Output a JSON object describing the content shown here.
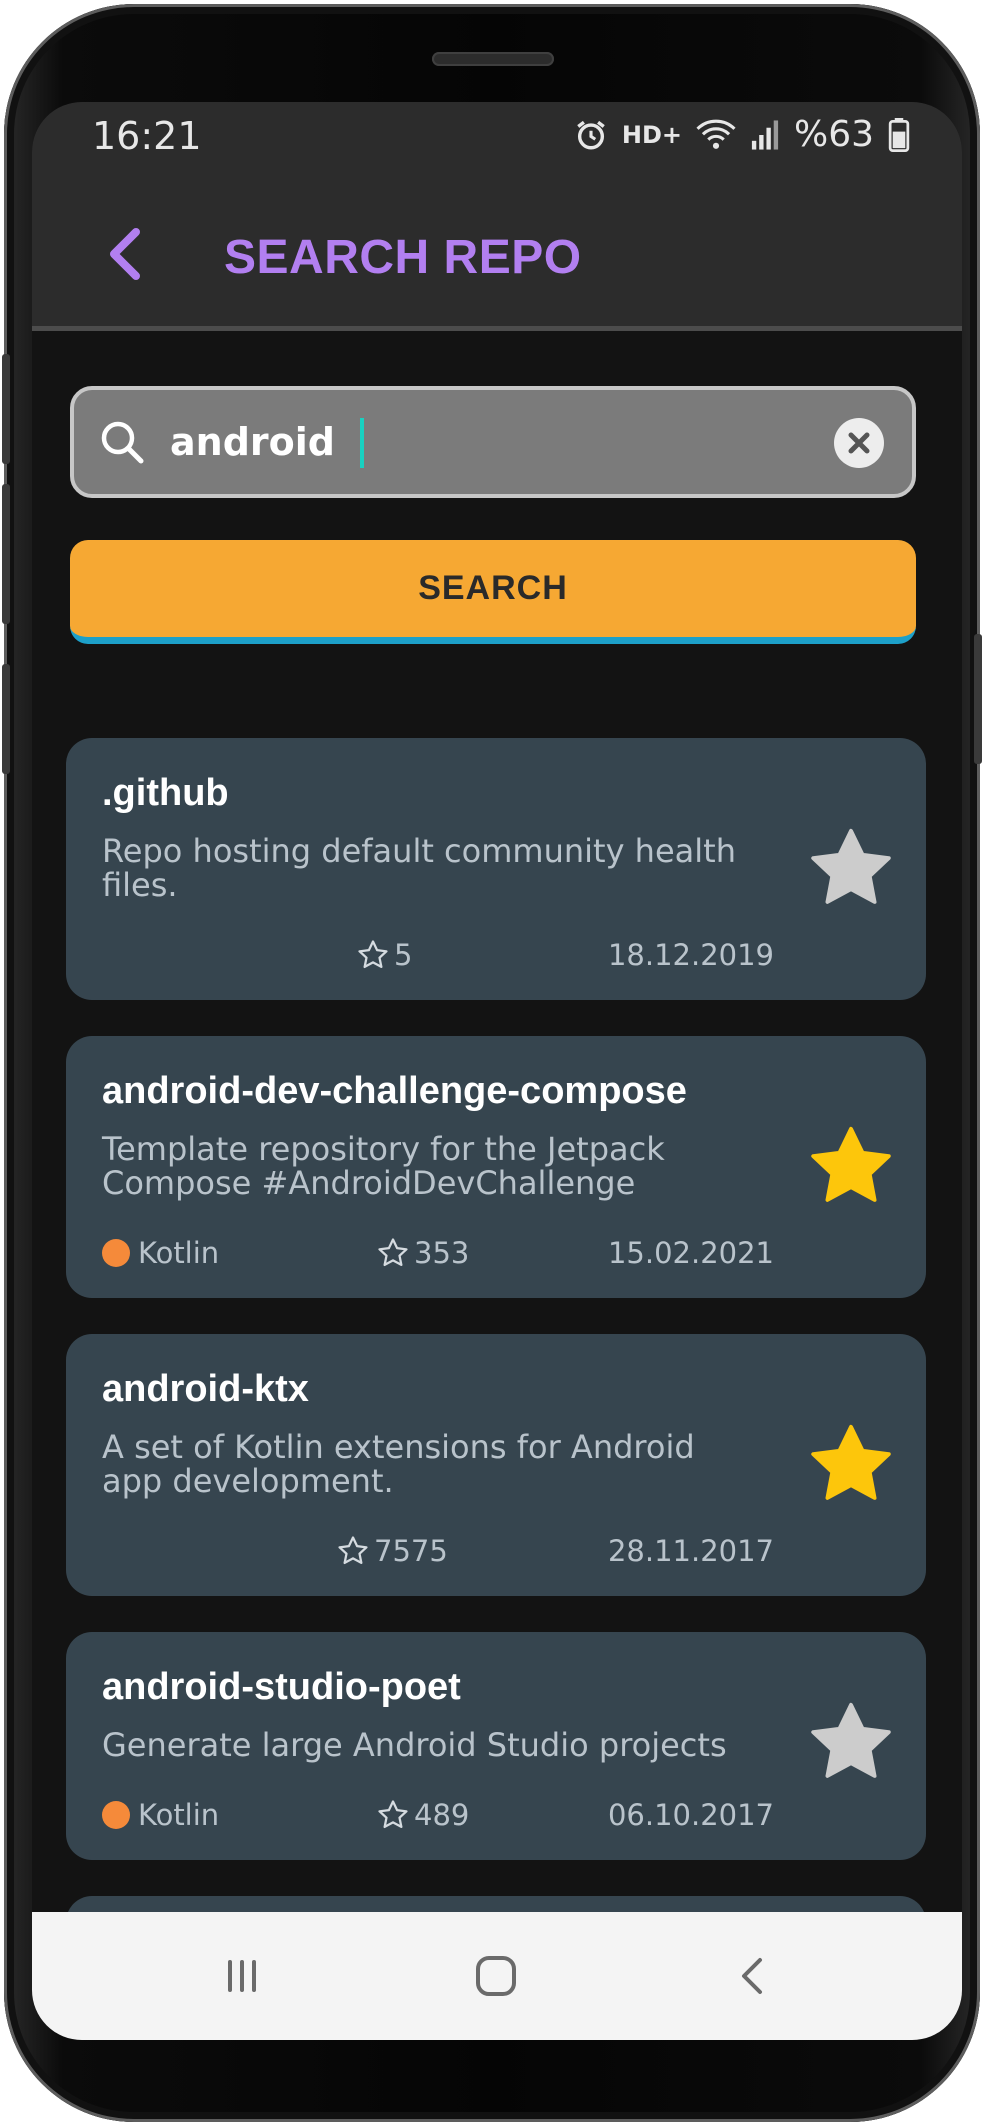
{
  "status_bar": {
    "time": "16:21",
    "network": "HD+",
    "battery": "%63",
    "icons": [
      "alarm-icon",
      "wifi-icon",
      "signal-icon",
      "battery-icon"
    ]
  },
  "app_bar": {
    "title": "SEARCH REPO",
    "back_icon": "chevron-left-icon"
  },
  "search": {
    "value": "android",
    "search_icon": "search-icon",
    "clear_icon": "close-icon",
    "button_label": "SEARCH"
  },
  "repos": [
    {
      "name": ".github",
      "description": "Repo hosting default community health files.",
      "language": "",
      "stars": "5",
      "date": "18.12.2019",
      "favorite": false
    },
    {
      "name": "android-dev-challenge-compose",
      "description": "Template repository for the Jetpack Compose #AndroidDevChallenge",
      "language": "Kotlin",
      "stars": "353",
      "date": "15.02.2021",
      "favorite": true
    },
    {
      "name": "android-ktx",
      "description": "A set of Kotlin extensions for Android app development.",
      "language": "",
      "stars": "7575",
      "date": "28.11.2017",
      "favorite": true
    },
    {
      "name": "android-studio-poet",
      "description": "Generate large Android Studio projects",
      "language": "Kotlin",
      "stars": "489",
      "date": "06.10.2017",
      "favorite": false
    }
  ],
  "colors": {
    "accent_title": "#b27ff0",
    "search_button": "#f6a833",
    "card_background": "#36454f",
    "favorite_star": "#fdc60b",
    "unfavorite_star": "#cccccc",
    "kotlin_dot": "#f58a3a"
  },
  "nav_bar": {
    "icons": [
      "recent-apps-icon",
      "home-icon",
      "back-icon"
    ]
  }
}
